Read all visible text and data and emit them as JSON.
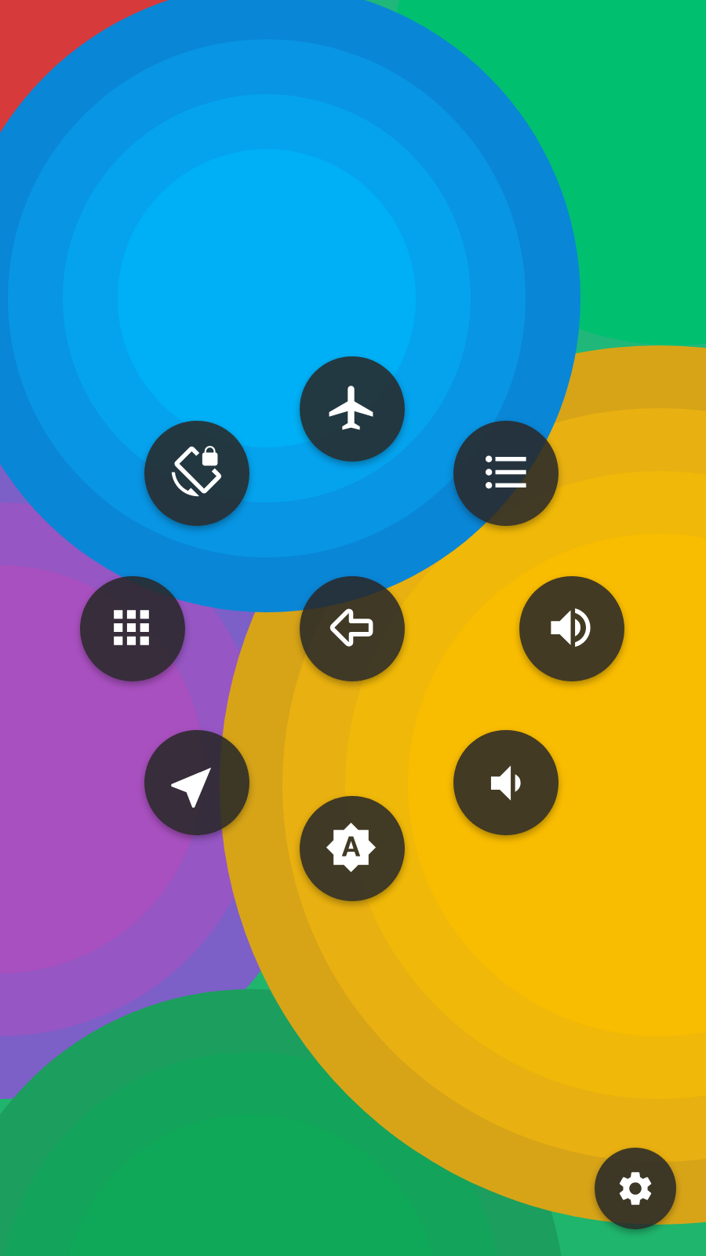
{
  "ring": [
    {
      "kind": "airplane"
    },
    {
      "kind": "list"
    },
    {
      "kind": "volume-up"
    },
    {
      "kind": "volume-down"
    },
    {
      "kind": "brightness-auto"
    },
    {
      "kind": "location"
    },
    {
      "kind": "apps"
    },
    {
      "kind": "rotation-lock"
    }
  ],
  "center": {
    "kind": "back"
  },
  "corner": {
    "kind": "settings"
  }
}
